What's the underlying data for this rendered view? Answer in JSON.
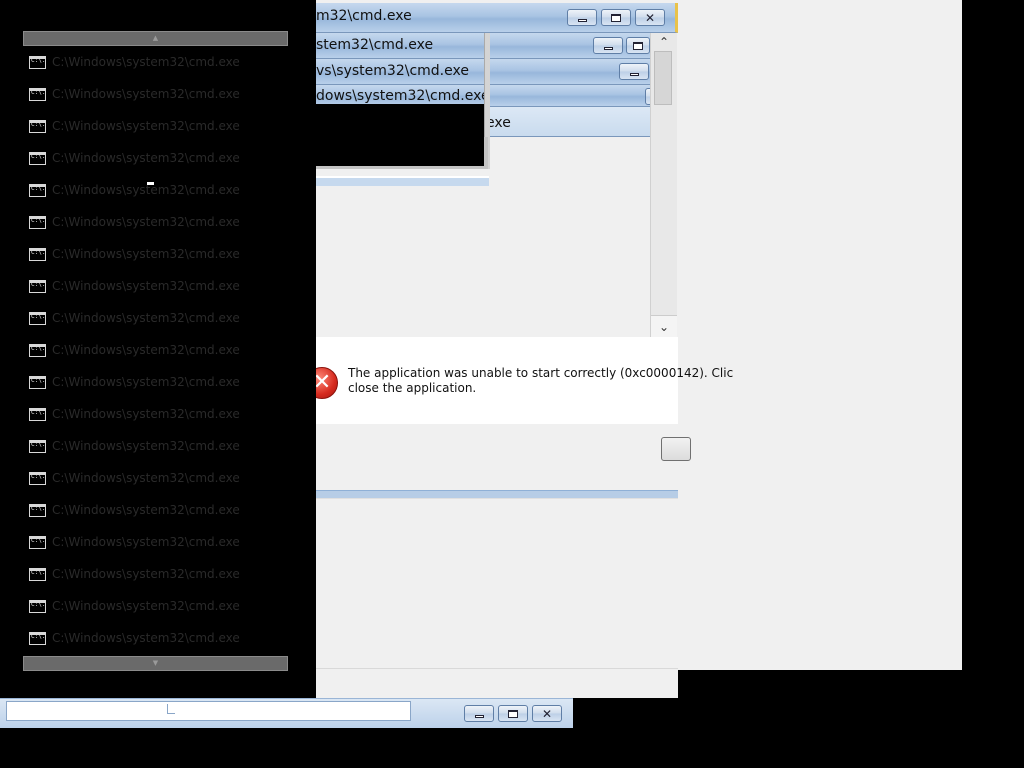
{
  "windows": {
    "title_1": "m32\\cmd.exe",
    "title_2": "stem32\\cmd.exe",
    "title_3": "vs\\system32\\cmd.exe",
    "title_4": "dows\\system32\\cmd.exe",
    "title_5": "exe"
  },
  "list": {
    "items": [
      "C:\\Windows\\system32\\cmd.exe",
      "C:\\Windows\\system32\\cmd.exe",
      "C:\\Windows\\system32\\cmd.exe",
      "C:\\Windows\\system32\\cmd.exe",
      "C:\\Windows\\system32\\cmd.exe",
      "C:\\Windows\\system32\\cmd.exe",
      "C:\\Windows\\system32\\cmd.exe",
      "C:\\Windows\\system32\\cmd.exe",
      "C:\\Windows\\system32\\cmd.exe",
      "C:\\Windows\\system32\\cmd.exe",
      "C:\\Windows\\system32\\cmd.exe",
      "C:\\Windows\\system32\\cmd.exe",
      "C:\\Windows\\system32\\cmd.exe",
      "C:\\Windows\\system32\\cmd.exe",
      "C:\\Windows\\system32\\cmd.exe",
      "C:\\Windows\\system32\\cmd.exe",
      "C:\\Windows\\system32\\cmd.exe",
      "C:\\Windows\\system32\\cmd.exe",
      "C:\\Windows\\system32\\cmd.exe"
    ],
    "icon": "cmd-prompt-icon",
    "icon_text": "C:\\."
  },
  "dialog": {
    "message_line_1": "The application was unable to start correctly (0xc0000142). Clic",
    "message_line_2": "close the application.",
    "icon": "error-icon",
    "icon_glyph": "✕"
  },
  "scrollbar": {
    "up_glyph": "⌃",
    "down_glyph": "⌄"
  },
  "caption_buttons": {
    "minimize": "minimize-icon",
    "maximize": "maximize-icon",
    "close_glyph": "✕"
  },
  "colors": {
    "error_red": "#d62b1f",
    "titlebar_blue": "#a9c4e3",
    "accent_yellow": "#e9c24a"
  }
}
